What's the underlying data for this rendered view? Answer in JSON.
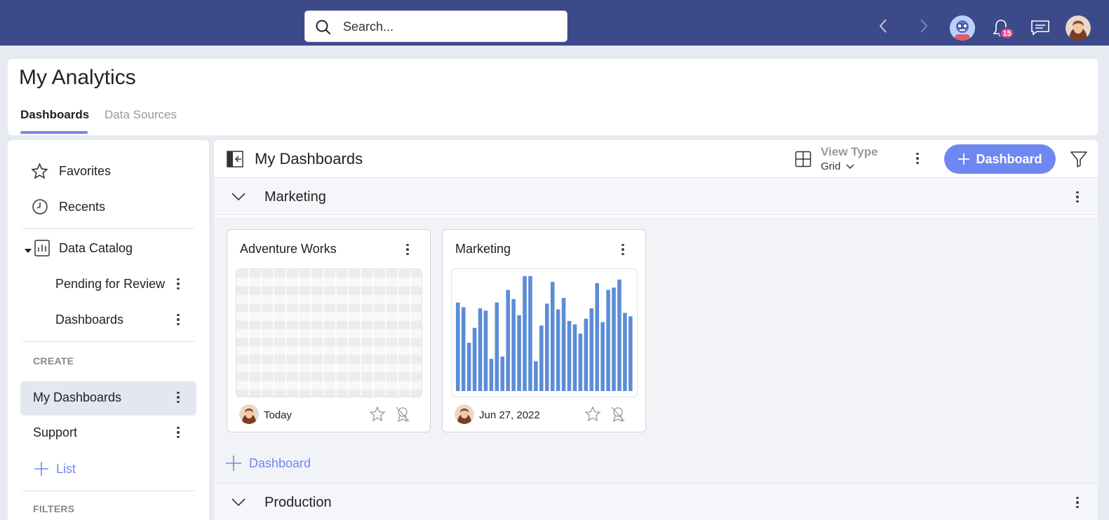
{
  "topbar": {
    "search_placeholder": "Search...",
    "notification_count": "15"
  },
  "header": {
    "title": "My Analytics",
    "tabs": [
      {
        "label": "Dashboards",
        "active": true
      },
      {
        "label": "Data Sources",
        "active": false
      }
    ]
  },
  "sidebar": {
    "favorites": "Favorites",
    "recents": "Recents",
    "data_catalog": "Data Catalog",
    "catalog_items": [
      "Pending for Review",
      "Dashboards"
    ],
    "create_label": "CREATE",
    "create_items": [
      "My Dashboards",
      "Support"
    ],
    "add_list": "List",
    "filters_label": "FILTERS"
  },
  "main": {
    "title": "My Dashboards",
    "view_type_label": "View Type",
    "view_type_value": "Grid",
    "add_button": "Dashboard",
    "sections": [
      {
        "name": "Marketing",
        "cards": [
          {
            "title": "Adventure Works",
            "date": "Today",
            "thumbnail": "table"
          },
          {
            "title": "Marketing",
            "date": "Jun 27, 2022",
            "thumbnail": "bar-chart"
          }
        ],
        "add_link": "Dashboard"
      },
      {
        "name": "Production"
      }
    ],
    "marketing_thumbnail_bars": [
      0.77,
      0.73,
      0.42,
      0.55,
      0.72,
      0.7,
      0.28,
      0.77,
      0.3,
      0.88,
      0.8,
      0.66,
      1.0,
      1.0,
      0.26,
      0.57,
      0.76,
      0.95,
      0.71,
      0.81,
      0.61,
      0.58,
      0.5,
      0.63,
      0.72,
      0.94,
      0.6,
      0.88,
      0.9,
      0.97,
      0.68,
      0.65
    ]
  },
  "colors": {
    "topbar": "#3d4a8a",
    "accent": "#6f87f1",
    "bar": "#5b8dd6",
    "badge": "#e3488a"
  }
}
